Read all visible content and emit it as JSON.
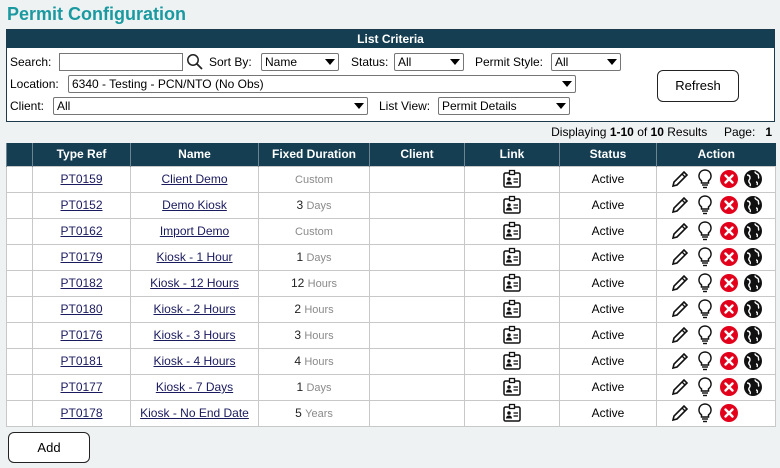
{
  "page": {
    "title": "Permit Configuration"
  },
  "criteria": {
    "header": "List Criteria",
    "search_label": "Search:",
    "search_value": "",
    "sort_label": "Sort By:",
    "sort_value": "Name",
    "status_label": "Status:",
    "status_value": "All",
    "permit_style_label": "Permit Style:",
    "permit_style_value": "All",
    "location_label": "Location:",
    "location_value": "6340 - Testing - PCN/NTO (No Obs)",
    "client_label": "Client:",
    "client_value": "All",
    "list_view_label": "List View:",
    "list_view_value": "Permit Details",
    "refresh_label": "Refresh"
  },
  "results": {
    "displaying_label": "Displaying",
    "range": "1-10",
    "of_label": "of",
    "total": "10",
    "results_label": "Results",
    "page_label": "Page:",
    "page": "1"
  },
  "table": {
    "headers": [
      "",
      "Type Ref",
      "Name",
      "Fixed Duration",
      "Client",
      "Link",
      "Status",
      "Action"
    ],
    "rows": [
      {
        "ref": "PT0159",
        "name": "Client Demo",
        "dur_num": "",
        "dur_unit": "Custom",
        "client": "",
        "status": "Active",
        "web": true
      },
      {
        "ref": "PT0152",
        "name": "Demo Kiosk",
        "dur_num": "3",
        "dur_unit": "Days",
        "client": "",
        "status": "Active",
        "web": true
      },
      {
        "ref": "PT0162",
        "name": "Import Demo",
        "dur_num": "",
        "dur_unit": "Custom",
        "client": "",
        "status": "Active",
        "web": true
      },
      {
        "ref": "PT0179",
        "name": "Kiosk - 1 Hour",
        "dur_num": "1",
        "dur_unit": "Days",
        "client": "",
        "status": "Active",
        "web": true
      },
      {
        "ref": "PT0182",
        "name": "Kiosk - 12 Hours",
        "dur_num": "12",
        "dur_unit": "Hours",
        "client": "",
        "status": "Active",
        "web": true
      },
      {
        "ref": "PT0180",
        "name": "Kiosk - 2 Hours",
        "dur_num": "2",
        "dur_unit": "Hours",
        "client": "",
        "status": "Active",
        "web": true
      },
      {
        "ref": "PT0176",
        "name": "Kiosk - 3 Hours",
        "dur_num": "3",
        "dur_unit": "Hours",
        "client": "",
        "status": "Active",
        "web": true
      },
      {
        "ref": "PT0181",
        "name": "Kiosk - 4 Hours",
        "dur_num": "4",
        "dur_unit": "Hours",
        "client": "",
        "status": "Active",
        "web": true
      },
      {
        "ref": "PT0177",
        "name": "Kiosk - 7 Days",
        "dur_num": "1",
        "dur_unit": "Days",
        "client": "",
        "status": "Active",
        "web": true
      },
      {
        "ref": "PT0178",
        "name": "Kiosk - No End Date",
        "dur_num": "5",
        "dur_unit": "Years",
        "client": "",
        "status": "Active",
        "web": false
      }
    ]
  },
  "footer": {
    "add_label": "Add"
  },
  "colors": {
    "title": "#1a9aa0",
    "header_bg": "#153e52",
    "delete": "#e3001b"
  },
  "icons": {
    "link": "id-badge-icon",
    "edit": "pencil-icon",
    "hint": "lightbulb-icon",
    "delete": "delete-x-icon",
    "web": "globe-icon",
    "search": "magnifier-icon"
  }
}
